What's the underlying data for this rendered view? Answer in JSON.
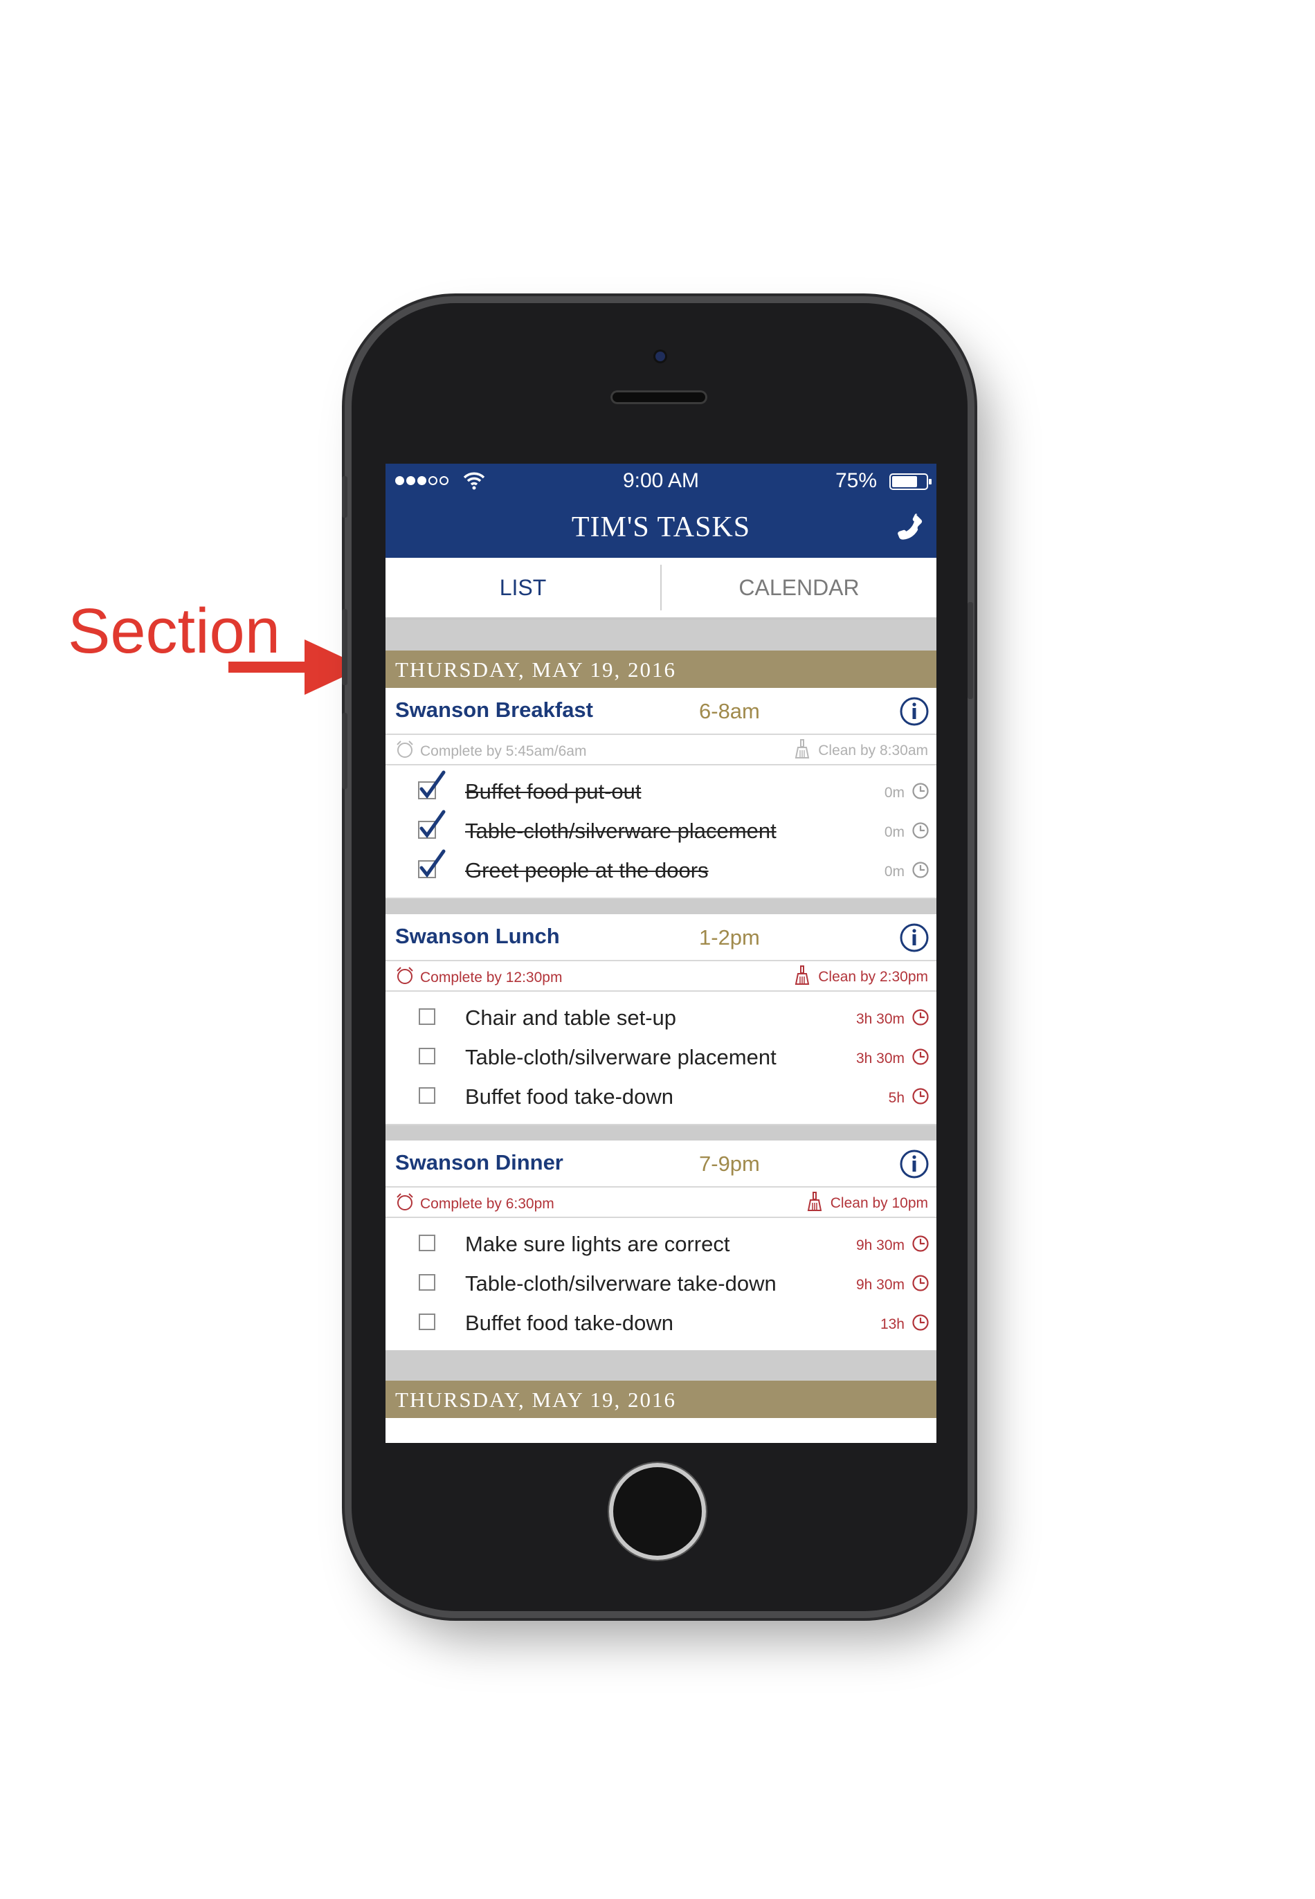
{
  "annotation": {
    "label": "Section",
    "color": "#e0392f"
  },
  "status_bar": {
    "time": "9:00 AM",
    "battery": "75%",
    "signal_bars": 3,
    "battery_level": 0.75
  },
  "nav": {
    "title": "TIM'S TASKS"
  },
  "tabs": [
    {
      "label": "LIST",
      "active": true
    },
    {
      "label": "CALENDAR",
      "active": false
    }
  ],
  "sections": [
    {
      "date": "THURSDAY, MAY 19, 2016",
      "events": [
        {
          "title": "Swanson Breakfast",
          "time": "6-8am",
          "complete_by": "Complete by 5:45am/6am",
          "clean_by": "Clean by 8:30am",
          "alert": false,
          "tasks": [
            {
              "text": "Buffet food put-out",
              "duration": "0m",
              "done": true
            },
            {
              "text": "Table-cloth/silverware placement",
              "duration": "0m",
              "done": true
            },
            {
              "text": "Greet people at the doors",
              "duration": "0m",
              "done": true
            }
          ]
        },
        {
          "title": "Swanson Lunch",
          "time": "1-2pm",
          "complete_by": "Complete by 12:30pm",
          "clean_by": "Clean by 2:30pm",
          "alert": true,
          "tasks": [
            {
              "text": "Chair and table set-up",
              "duration": "3h 30m",
              "done": false
            },
            {
              "text": "Table-cloth/silverware placement",
              "duration": "3h 30m",
              "done": false
            },
            {
              "text": "Buffet food take-down",
              "duration": "5h",
              "done": false
            }
          ]
        },
        {
          "title": "Swanson Dinner",
          "time": "7-9pm",
          "complete_by": "Complete by 6:30pm",
          "clean_by": "Clean by 10pm",
          "alert": true,
          "tasks": [
            {
              "text": "Make sure lights are correct",
              "duration": "9h 30m",
              "done": false
            },
            {
              "text": "Table-cloth/silverware take-down",
              "duration": "9h 30m",
              "done": false
            },
            {
              "text": "Buffet food take-down",
              "duration": "13h",
              "done": false
            }
          ]
        }
      ]
    },
    {
      "date": "THURSDAY, MAY 19, 2016",
      "events": []
    }
  ],
  "colors": {
    "nav": "#1b3a7a",
    "section": "#a0916a",
    "alert": "#b2343a",
    "time": "#a08a4c"
  }
}
